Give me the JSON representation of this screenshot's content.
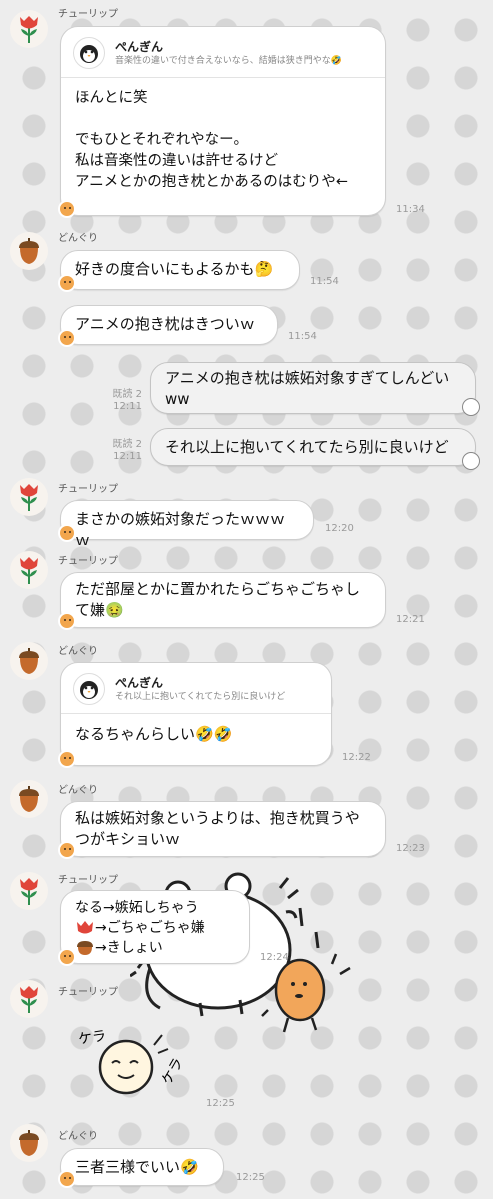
{
  "contacts": {
    "tulip": "チューリップ",
    "acorn": "どんぐり",
    "penguin": "ぺんぎん"
  },
  "messages": {
    "m1": {
      "quote_name": "ぺんぎん",
      "quote_text": "音楽性の違いで付き合えないなら、結婚は狭き門やな🤣",
      "text": "ほんとに笑\n\nでもひとそれぞれやなー。\n私は音楽性の違いは許せるけど\nアニメとかの抱き枕とかあるのはむりや←",
      "time": "11:34"
    },
    "m2": {
      "text": "好きの度合いにもよるかも🤔",
      "time": "11:54"
    },
    "m3": {
      "text": "アニメの抱き枕はきついｗ",
      "time": "11:54"
    },
    "m4": {
      "text": "アニメの抱き枕は嫉妬対象すぎてしんどいww",
      "read": "既読 2",
      "time": "12:11"
    },
    "m5": {
      "text": "それ以上に抱いてくれてたら別に良いけど",
      "read": "既読 2",
      "time": "12:11"
    },
    "m6": {
      "text": "まさかの嫉妬対象だったｗｗｗｗ",
      "time": "12:20"
    },
    "m7": {
      "text": "ただ部屋とかに置かれたらごちゃごちゃして嫌🤢",
      "time": "12:21"
    },
    "m8": {
      "quote_name": "ぺんぎん",
      "quote_text": "それ以上に抱いてくれてたら別に良いけど",
      "text": "なるちゃんらしい🤣🤣",
      "time": "12:22"
    },
    "m9": {
      "text": "私は嫉妬対象というよりは、抱き枕買うやつがキショいｗ",
      "time": "12:23"
    },
    "m10": {
      "line1": "なる→嫉妬しちゃう",
      "line2": "→ごちゃごちゃ嫌",
      "line3": "→きしょい",
      "time": "12:24"
    },
    "m11": {
      "sticker_text1": "ケラ",
      "sticker_text2": "ケラ",
      "time": "12:25"
    },
    "m12": {
      "text": "三者三様でいい🤣",
      "time": "12:25"
    }
  },
  "colors": {
    "tulip_red": "#e0453a",
    "acorn_brown": "#b5652a",
    "background_dots": "#d6d6d6",
    "background": "#ededed"
  },
  "icons": [
    "tulip-icon",
    "acorn-icon",
    "penguin-icon",
    "bear-sticker",
    "potato-sticker"
  ]
}
